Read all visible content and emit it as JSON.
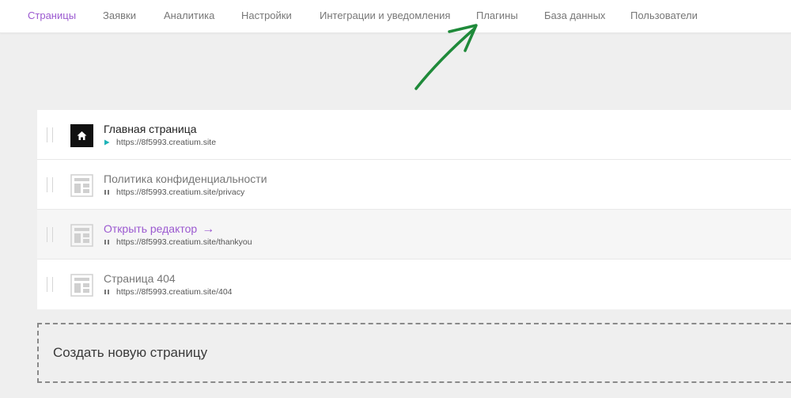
{
  "nav": {
    "items": [
      {
        "label": "Страницы",
        "active": true
      },
      {
        "label": "Заявки"
      },
      {
        "label": "Аналитика"
      },
      {
        "label": "Настройки"
      },
      {
        "label": "Интеграции и уведомления"
      },
      {
        "label": "Плагины"
      },
      {
        "label": "База данных"
      },
      {
        "label": "Пользователи"
      }
    ]
  },
  "pages": [
    {
      "title": "Главная страница",
      "url": "https://8f5993.creatium.site",
      "icon": "home-icon",
      "status": "published-play-icon"
    },
    {
      "title": "Политика конфиденциальности",
      "url": "https://8f5993.creatium.site/privacy",
      "icon": "page-layout-icon",
      "status": "paused-icon"
    },
    {
      "title": "Открыть редактор",
      "arrow": "→",
      "url": "https://8f5993.creatium.site/thankyou",
      "icon": "page-layout-icon",
      "status": "paused-icon"
    },
    {
      "title": "Страница 404",
      "url": "https://8f5993.creatium.site/404",
      "icon": "page-layout-icon",
      "status": "paused-icon"
    }
  ],
  "create_page": {
    "label": "Создать новую страницу"
  },
  "colors": {
    "accent": "#9b59d0",
    "play": "#1fb3b8",
    "annotation_arrow": "#1f8a3a",
    "background": "#efefef"
  }
}
